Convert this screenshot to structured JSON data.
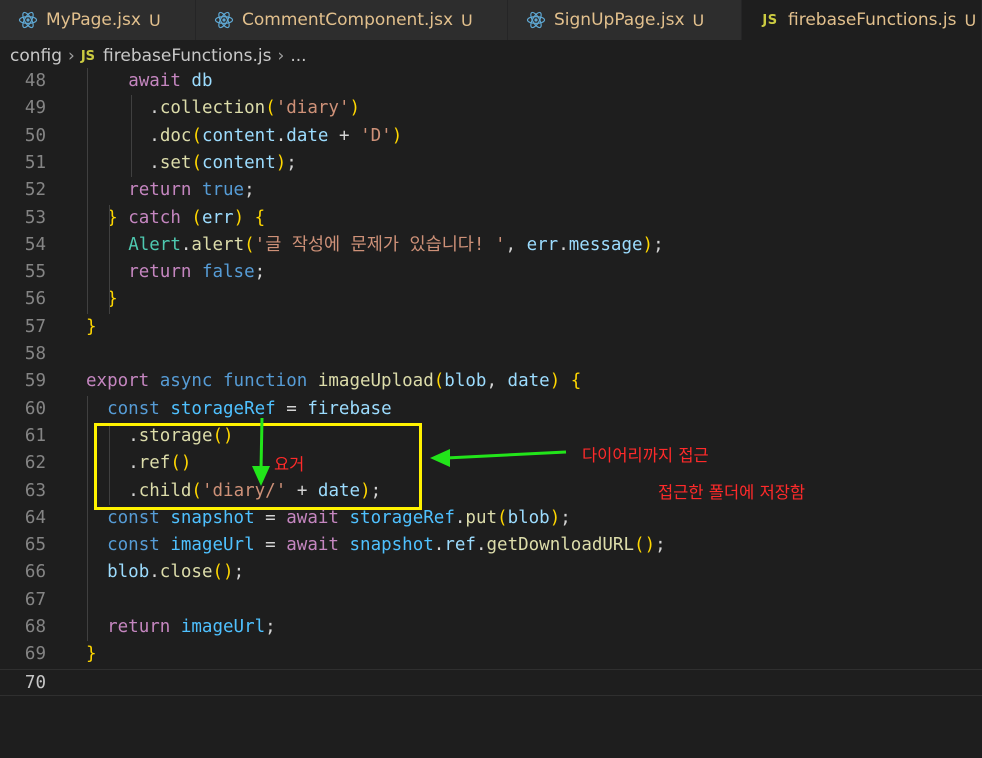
{
  "tabs": [
    {
      "label": "MyPage.jsx",
      "status": "U",
      "icon": "react-icon"
    },
    {
      "label": "CommentComponent.jsx",
      "status": "U",
      "icon": "react-icon"
    },
    {
      "label": "SignUpPage.jsx",
      "status": "U",
      "icon": "react-icon"
    },
    {
      "label": "firebaseFunctions.js",
      "status": "U",
      "icon": "js-icon",
      "badge": "JS",
      "active": true
    }
  ],
  "breadcrumb": {
    "folder": "config",
    "badge": "JS",
    "file": "firebaseFunctions.js",
    "more": "..."
  },
  "code_lines": [
    {
      "n": "48",
      "code": "    await db"
    },
    {
      "n": "49",
      "code": "      .collection('diary')"
    },
    {
      "n": "50",
      "code": "      .doc(content.date + 'D')"
    },
    {
      "n": "51",
      "code": "      .set(content);"
    },
    {
      "n": "52",
      "code": "    return true;"
    },
    {
      "n": "53",
      "code": "  } catch (err) {"
    },
    {
      "n": "54",
      "code": "    Alert.alert('글 작성에 문제가 있습니다! ', err.message);"
    },
    {
      "n": "55",
      "code": "    return false;"
    },
    {
      "n": "56",
      "code": "  }"
    },
    {
      "n": "57",
      "code": "}"
    },
    {
      "n": "58",
      "code": ""
    },
    {
      "n": "59",
      "code": "export async function imageUpload(blob, date) {"
    },
    {
      "n": "60",
      "code": "  const storageRef = firebase"
    },
    {
      "n": "61",
      "code": "    .storage()"
    },
    {
      "n": "62",
      "code": "    .ref()"
    },
    {
      "n": "63",
      "code": "    .child('diary/' + date);"
    },
    {
      "n": "64",
      "code": "  const snapshot = await storageRef.put(blob);"
    },
    {
      "n": "65",
      "code": "  const imageUrl = await snapshot.ref.getDownloadURL();"
    },
    {
      "n": "66",
      "code": "  blob.close();"
    },
    {
      "n": "67",
      "code": ""
    },
    {
      "n": "68",
      "code": "  return imageUrl;"
    },
    {
      "n": "69",
      "code": "}"
    },
    {
      "n": "70",
      "code": "",
      "current": true
    }
  ],
  "annotations": {
    "here": "요거",
    "access_to_diary": "다이어리까지 접근",
    "save_to_folder": "접근한 폴더에 저장함"
  },
  "colors": {
    "highlight_box": "#fff200",
    "arrow": "#22e51a",
    "annotation_text": "#ff2a2a"
  }
}
